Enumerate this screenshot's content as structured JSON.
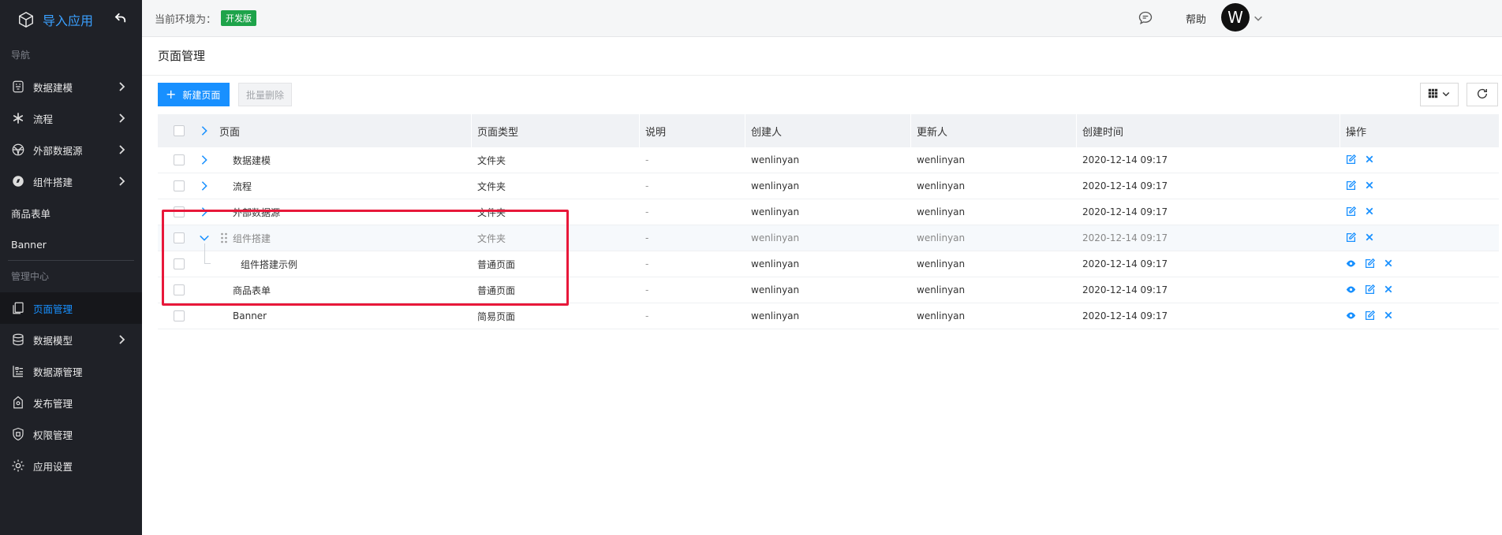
{
  "app": {
    "title": "导入应用"
  },
  "sidebar": {
    "section_nav": "导航",
    "nav_items": [
      {
        "label": "数据建模",
        "icon": "database-model-icon",
        "has_children": true
      },
      {
        "label": "流程",
        "icon": "asterisk-icon",
        "has_children": true
      },
      {
        "label": "外部数据源",
        "icon": "globe-icon",
        "has_children": true
      },
      {
        "label": "组件搭建",
        "icon": "compass-icon",
        "has_children": true
      },
      {
        "label": "商品表单",
        "has_children": false
      },
      {
        "label": "Banner",
        "has_children": false
      }
    ],
    "section_admin": "管理中心",
    "admin_items": [
      {
        "label": "页面管理",
        "icon": "pages-icon",
        "active": true
      },
      {
        "label": "数据模型",
        "icon": "database-icon",
        "has_children": true
      },
      {
        "label": "数据源管理",
        "icon": "data-source-icon"
      },
      {
        "label": "发布管理",
        "icon": "publish-icon"
      },
      {
        "label": "权限管理",
        "icon": "shield-icon"
      },
      {
        "label": "应用设置",
        "icon": "gear-icon"
      }
    ]
  },
  "topbar": {
    "env_label": "当前环境为：",
    "env_badge": "开发版",
    "help": "帮助",
    "avatar_letter": "W"
  },
  "page": {
    "title": "页面管理",
    "new_page_label": "新建页面",
    "batch_delete_label": "批量删除"
  },
  "table": {
    "columns": [
      "页面",
      "页面类型",
      "说明",
      "创建人",
      "更新人",
      "创建时间",
      "操作"
    ],
    "rows": [
      {
        "name": "数据建模",
        "type": "文件夹",
        "desc": "-",
        "creator": "wenlinyan",
        "updater": "wenlinyan",
        "created": "2020-12-14 09:17",
        "expander": "collapsed",
        "ops": [
          "edit",
          "delete"
        ]
      },
      {
        "name": "流程",
        "type": "文件夹",
        "desc": "-",
        "creator": "wenlinyan",
        "updater": "wenlinyan",
        "created": "2020-12-14 09:17",
        "expander": "collapsed",
        "ops": [
          "edit",
          "delete"
        ]
      },
      {
        "name": "外部数据源",
        "type": "文件夹",
        "desc": "-",
        "creator": "wenlinyan",
        "updater": "wenlinyan",
        "created": "2020-12-14 09:17",
        "expander": "collapsed",
        "ops": [
          "edit",
          "delete"
        ]
      },
      {
        "name": "组件搭建",
        "type": "文件夹",
        "desc": "-",
        "creator": "wenlinyan",
        "updater": "wenlinyan",
        "created": "2020-12-14 09:17",
        "expander": "expanded",
        "ops": [
          "edit",
          "delete"
        ]
      },
      {
        "name": "组件搭建示例",
        "type": "普通页面",
        "desc": "-",
        "creator": "wenlinyan",
        "updater": "wenlinyan",
        "created": "2020-12-14 09:17",
        "expander": "child",
        "ops": [
          "view",
          "edit",
          "delete"
        ]
      },
      {
        "name": "商品表单",
        "type": "普通页面",
        "desc": "-",
        "creator": "wenlinyan",
        "updater": "wenlinyan",
        "created": "2020-12-14 09:17",
        "expander": "none",
        "ops": [
          "view",
          "edit",
          "delete"
        ]
      },
      {
        "name": "Banner",
        "type": "简易页面",
        "desc": "-",
        "creator": "wenlinyan",
        "updater": "wenlinyan",
        "created": "2020-12-14 09:17",
        "expander": "none",
        "ops": [
          "view",
          "edit",
          "delete"
        ]
      }
    ]
  },
  "colors": {
    "sidebar_bg": "#1f2127",
    "accent": "#1890ff",
    "env_badge": "#1ea34a",
    "highlight_box": "#e8183a"
  }
}
